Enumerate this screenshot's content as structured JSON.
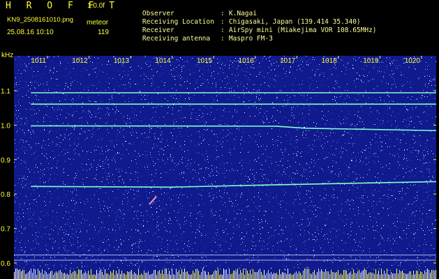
{
  "header": {
    "app_title": "H R O F F T",
    "app_version": "1.0.0f",
    "filename": "KN9_2508161010.png",
    "mode": "meteor",
    "datetime": "25.08.16 10:10",
    "count": "119"
  },
  "info": [
    {
      "label": "Observer",
      "value": "K.Nagai"
    },
    {
      "label": "Receiving Location",
      "value": "Chigasaki, Japan (139.414 35.340)"
    },
    {
      "label": "Receiver",
      "value": "AirSpy mini (Miakejima VOR 108.65MHz)"
    },
    {
      "label": "Receiving antenna",
      "value": "Maspro FM-3"
    }
  ],
  "info_separator": ":",
  "colors": {
    "background": "#000000",
    "plot_background": "#101a8c",
    "text_yellow": "#ffff3a",
    "grid": "#ffff3a",
    "trace": "#7fffd0"
  },
  "chart_data": {
    "type": "heatmap",
    "description_kind": "spectrogram waterfall",
    "xlabel": "",
    "ylabel": "kHz",
    "x_ticks": [
      "1011",
      "1012",
      "1013",
      "1014",
      "1015",
      "1016",
      "1017",
      "1018",
      "1019",
      "1020"
    ],
    "y_ticks": [
      "1.1",
      "1.0",
      "0.9",
      "0.8",
      "0.7",
      "0.6"
    ],
    "ylim": [
      0.58,
      1.2
    ],
    "traces": [
      {
        "points": [
          [
            1010.6,
            1.094
          ],
          [
            1020.4,
            1.094
          ]
        ]
      },
      {
        "points": [
          [
            1010.6,
            1.061
          ],
          [
            1020.4,
            1.061
          ]
        ]
      },
      {
        "points": [
          [
            1010.6,
            0.998
          ],
          [
            1016.5,
            0.997
          ],
          [
            1017.2,
            0.991
          ],
          [
            1020.4,
            0.984
          ]
        ]
      },
      {
        "points": [
          [
            1010.6,
            0.822
          ],
          [
            1014.0,
            0.82
          ],
          [
            1016.5,
            0.827
          ],
          [
            1020.4,
            0.836
          ]
        ]
      }
    ],
    "meteor": {
      "points": [
        [
          1013.45,
          0.77
        ],
        [
          1013.62,
          0.793
        ]
      ]
    },
    "baseline_lines": [
      0.623,
      0.608
    ]
  }
}
